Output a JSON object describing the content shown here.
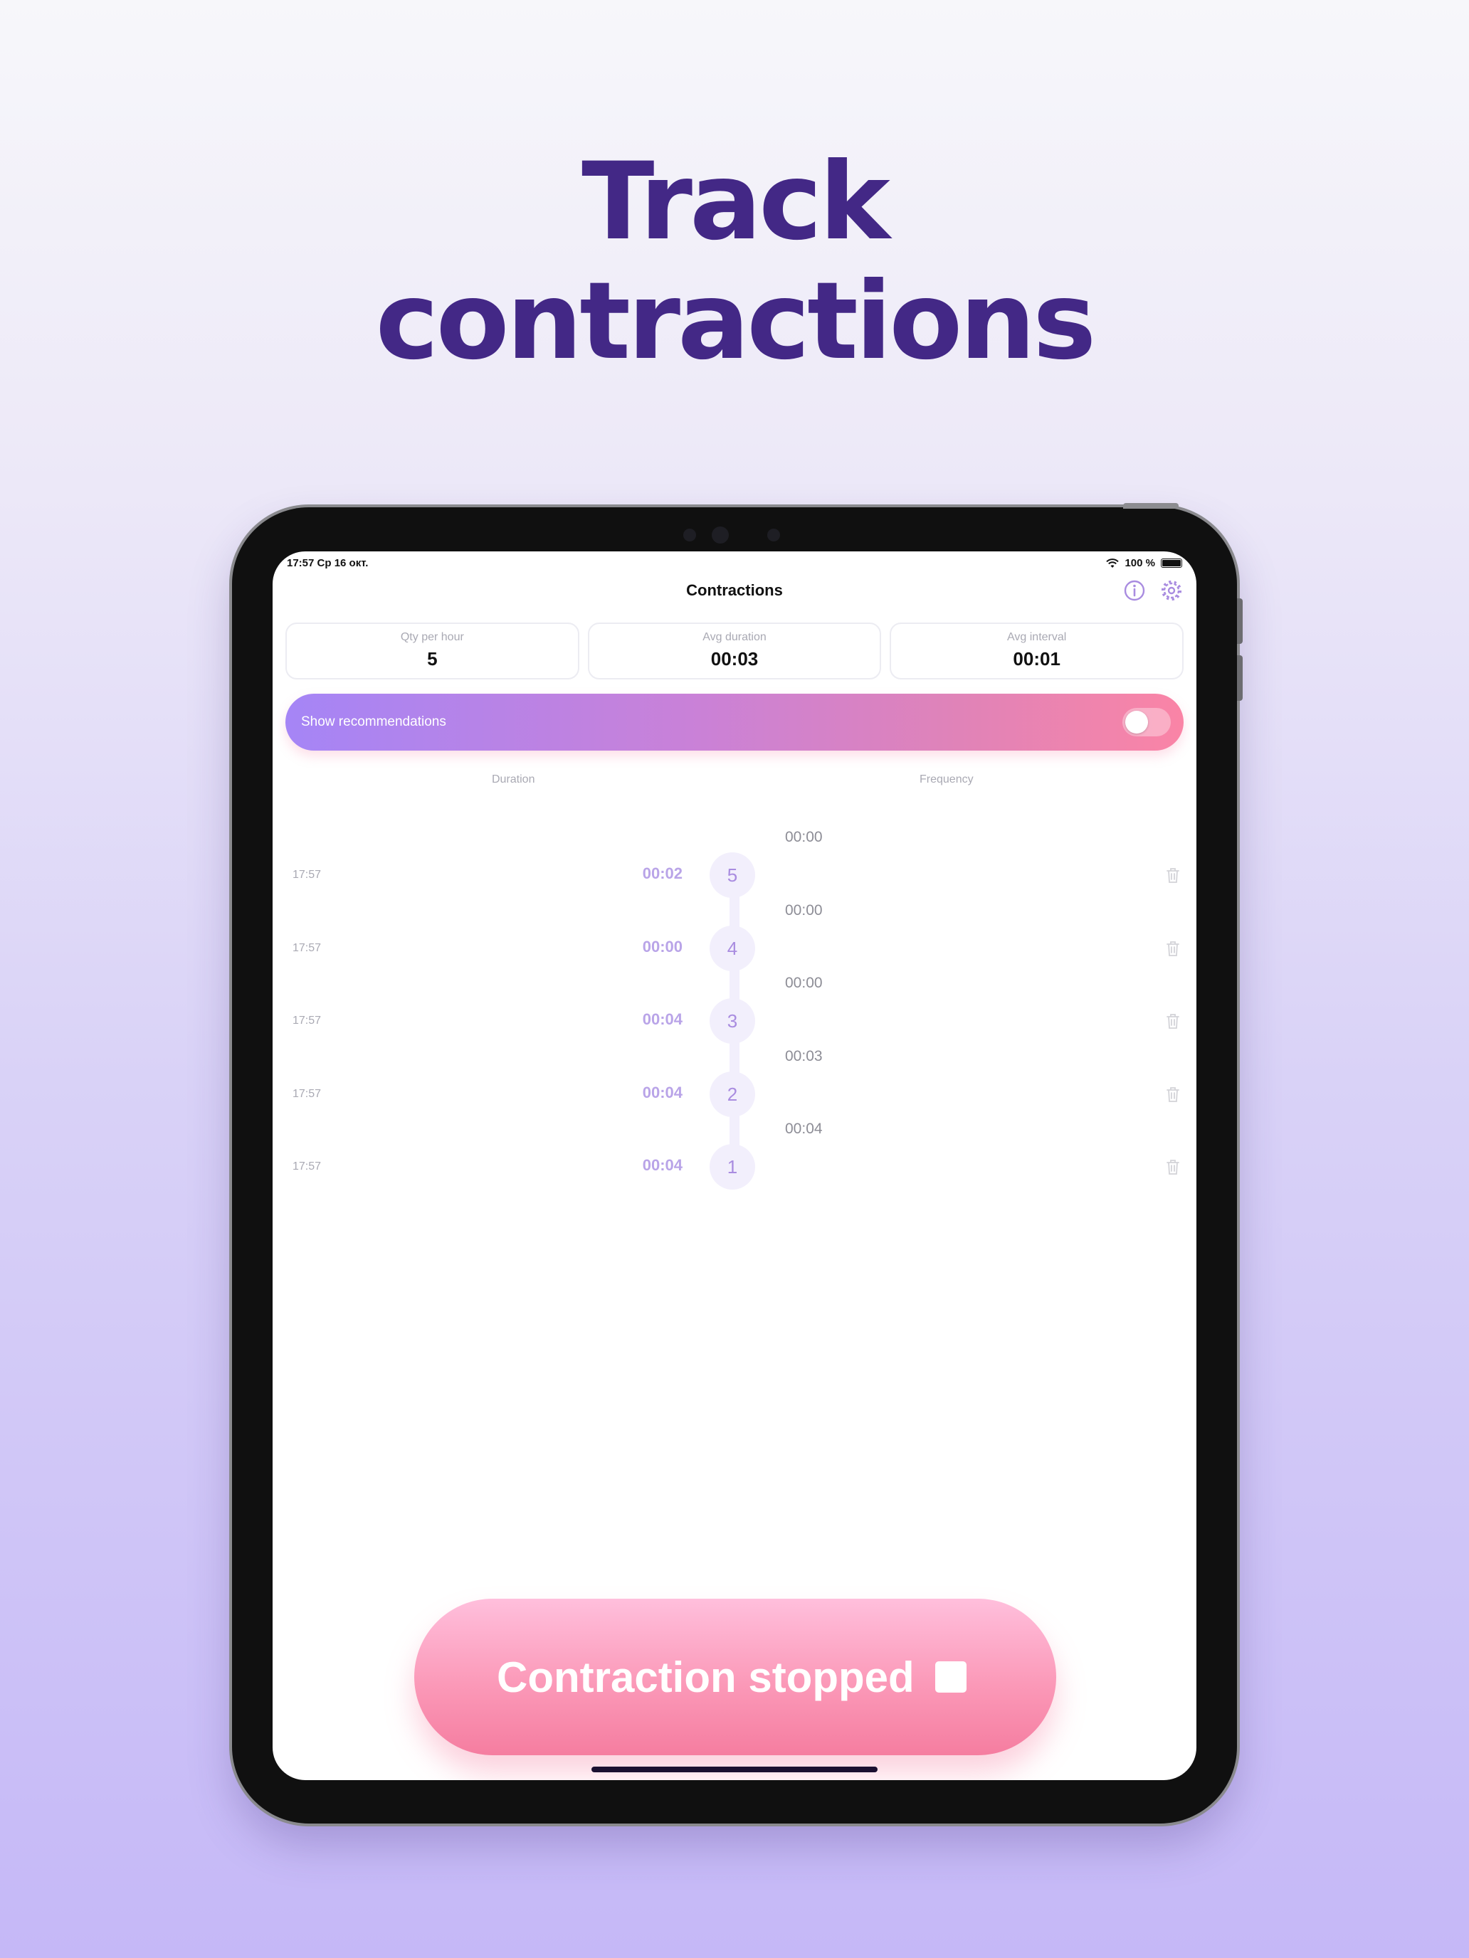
{
  "headline": {
    "line1": "Track",
    "line2": "contractions"
  },
  "status_bar": {
    "time_date": "17:57  Ср 16 окт.",
    "battery": "100 %"
  },
  "nav": {
    "title": "Contractions",
    "info_icon": "info-icon",
    "settings_icon": "gear-icon"
  },
  "stats": [
    {
      "label": "Qty per hour",
      "value": "5"
    },
    {
      "label": "Avg duration",
      "value": "00:03"
    },
    {
      "label": "Avg interval",
      "value": "00:01"
    }
  ],
  "recommendations": {
    "label": "Show recommendations",
    "enabled": false
  },
  "columns": {
    "duration": "Duration",
    "frequency": "Frequency"
  },
  "contractions": [
    {
      "time": "17:57",
      "duration": "00:02",
      "number": "5"
    },
    {
      "time": "17:57",
      "duration": "00:00",
      "number": "4"
    },
    {
      "time": "17:57",
      "duration": "00:04",
      "number": "3"
    },
    {
      "time": "17:57",
      "duration": "00:04",
      "number": "2"
    },
    {
      "time": "17:57",
      "duration": "00:04",
      "number": "1"
    }
  ],
  "frequencies": [
    "00:00",
    "00:00",
    "00:00",
    "00:03",
    "00:04"
  ],
  "cta": {
    "label": "Contraction stopped",
    "icon": "stop-icon"
  },
  "colors": {
    "headline": "#432886",
    "accent": "#a98ce0",
    "cta_pink": "#f57da0"
  }
}
